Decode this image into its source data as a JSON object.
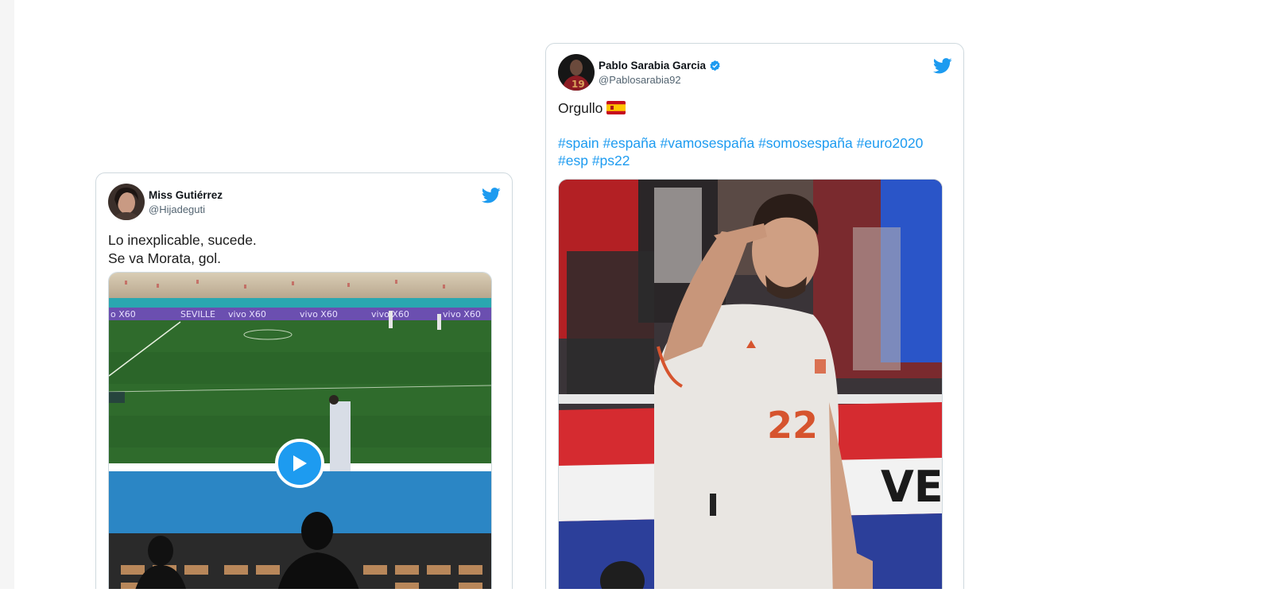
{
  "tweets": [
    {
      "author": {
        "name": "Miss Gutiérrez",
        "handle": "@Hijadeguti"
      },
      "text_lines": [
        "Lo inexplicable, sucede.",
        "Se va Morata, gol."
      ],
      "media": {
        "type": "video",
        "banner_text": "vivo X60"
      }
    },
    {
      "author": {
        "name": "Pablo Sarabia Garcia",
        "handle": "@Pablosarabia92",
        "verified": true
      },
      "text_lines": [
        "Orgullo"
      ],
      "hashtags": [
        "#spain",
        "#españa",
        "#vamosespaña",
        "#somosespaña",
        "#euro2020",
        "#esp",
        "#ps22"
      ],
      "media": {
        "type": "photo",
        "jersey_number": "22",
        "banner_text": "VE"
      }
    }
  ],
  "colors": {
    "accent": "#1d9bf0",
    "handle": "#536471",
    "border": "#cfd9de"
  }
}
